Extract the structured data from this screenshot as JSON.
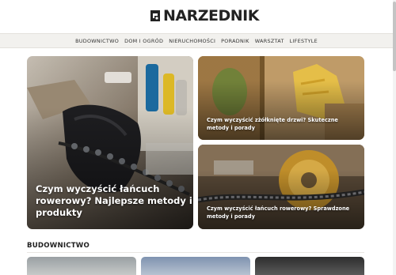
{
  "site": {
    "logo_text": "NARZEDNIK"
  },
  "nav": {
    "items": [
      "Budownictwo",
      "Dom i ogród",
      "Nieruchomości",
      "Poradnik",
      "Warsztat",
      "Lifestyle"
    ]
  },
  "featured": {
    "main": {
      "title": "Czym wyczyścić łańcuch rowerowy? Najlepsze metody i produkty",
      "image": "bike-chain-gloved-hand"
    },
    "side": [
      {
        "title": "Czym wyczyścić zżółknięte drzwi? Skuteczne metody i porady",
        "image": "yellow-glove-cleaning-door"
      },
      {
        "title": "Czym wyczyścić łańcuch rowerowy? Sprawdzone metody i porady",
        "image": "bike-chain-gears"
      }
    ]
  },
  "section": {
    "title": "BUDOWNICTWO"
  },
  "colors": {
    "nav_bg": "#f2f1ee",
    "text_dark": "#222222",
    "overlay_text": "#ffffff"
  }
}
